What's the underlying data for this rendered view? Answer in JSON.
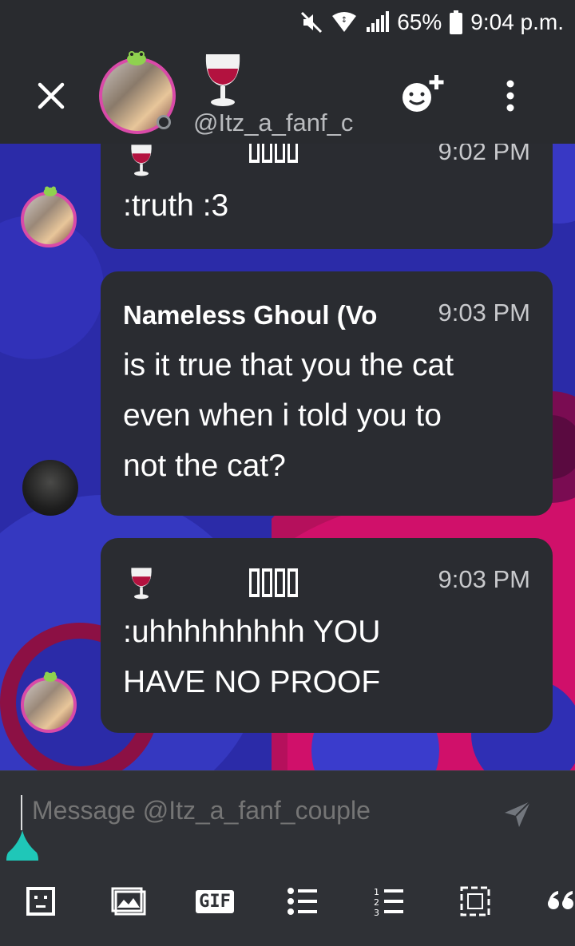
{
  "status_bar": {
    "battery": "65%",
    "time": "9:04 p.m.",
    "icons": [
      "mute-icon",
      "wifi-icon",
      "signal-icon",
      "battery-icon"
    ]
  },
  "header": {
    "username": "@Itz_a_fanf_c",
    "icons": [
      "close-icon",
      "wine-glass-icon",
      "add-friend-icon",
      "more-vertical-icon"
    ]
  },
  "messages": [
    {
      "time": "9:02 PM",
      "text": ":truth :3",
      "badge": "NO GIPH"
    },
    {
      "name": "Nameless Ghoul (Vo",
      "time": "9:03 PM",
      "lines": [
        "is it true that you the cat",
        "even when i told you to",
        "not the cat?"
      ]
    },
    {
      "time": "9:03 PM",
      "lines": [
        ":uhhhhhhhhh YOU",
        "HAVE NO PROOF"
      ],
      "badge": "NO GIPH"
    }
  ],
  "composer": {
    "placeholder": "Message @Itz_a_fanf_couple"
  },
  "toolbar": {
    "gif_label": "GIF",
    "icons": [
      "sticker-icon",
      "image-icon",
      "gif-icon",
      "bulleted-list-icon",
      "numbered-list-icon",
      "spoiler-icon",
      "quote-icon"
    ]
  },
  "colors": {
    "background": "#2f3136",
    "bubble": "#2a2c31",
    "avatar_ring": "#d94aa8",
    "accent_teal": "#1fc7b8",
    "chat_bg_blue": "#2b2ba8",
    "chat_bg_pink": "#d0106a"
  }
}
